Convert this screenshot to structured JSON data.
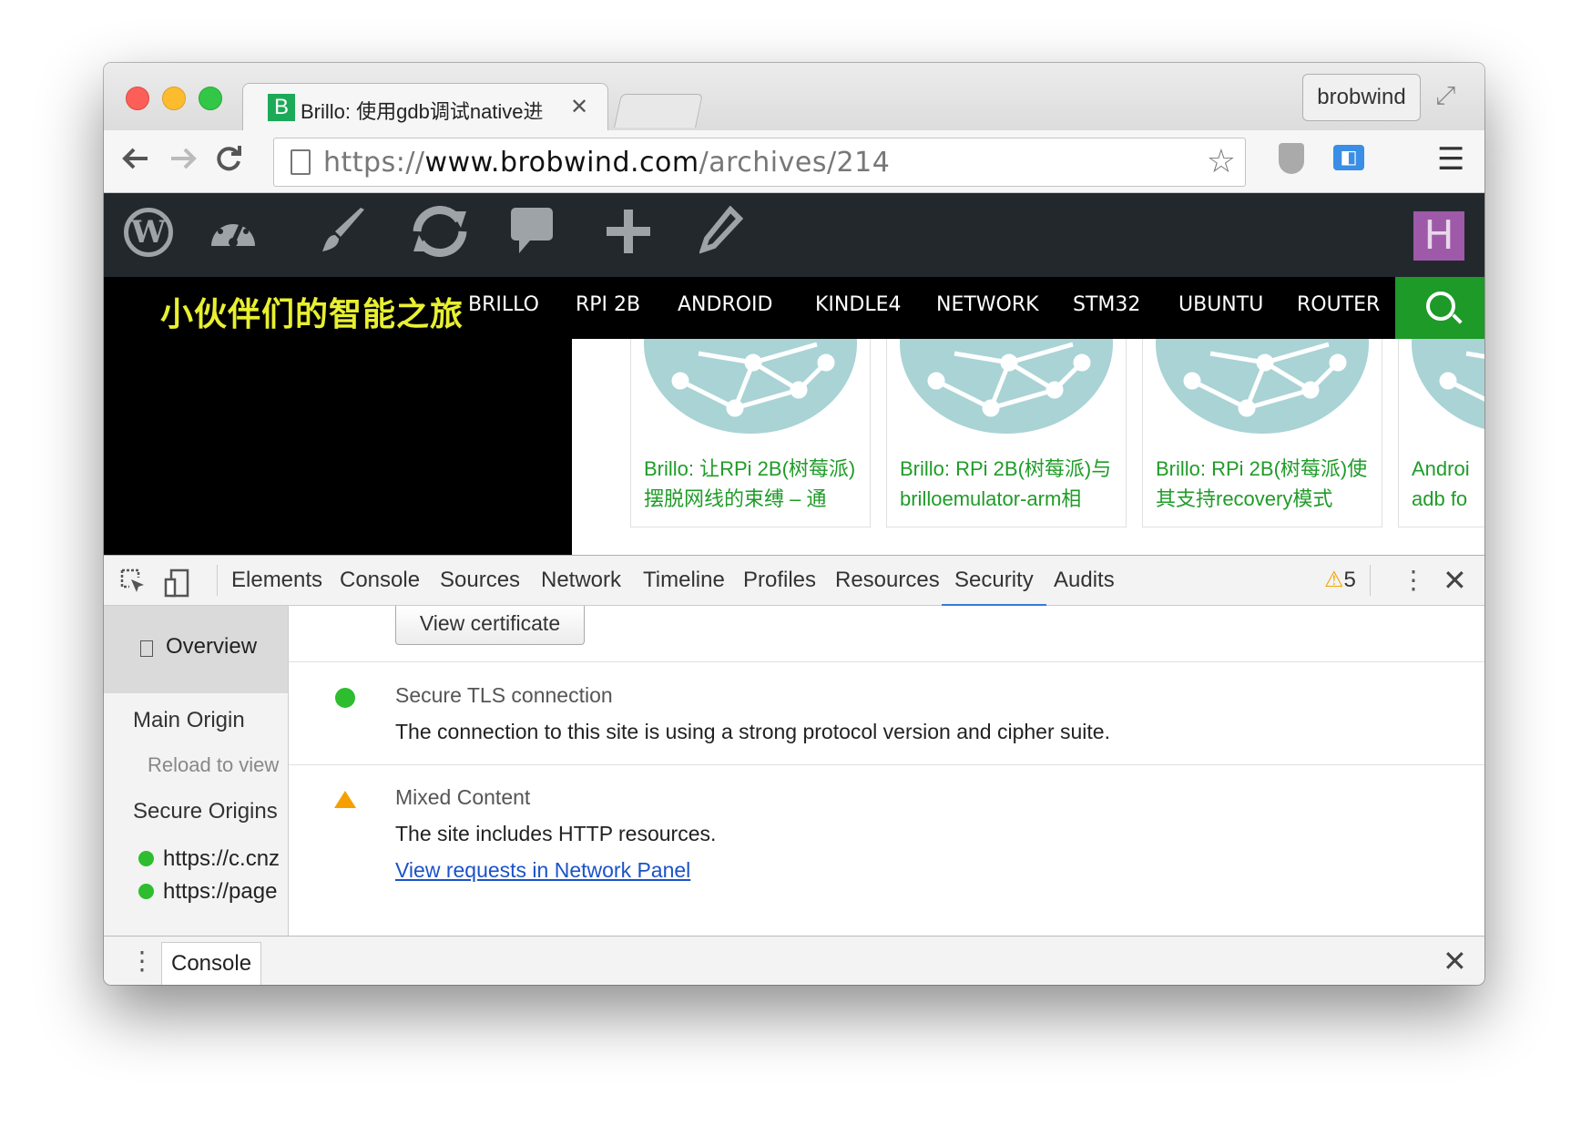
{
  "browser": {
    "tab_title": "Brillo: 使用gdb调试native进",
    "tab_favicon": "B",
    "profile_name": "brobwind",
    "url_scheme": "https://",
    "url_host": "www.brobwind.com",
    "url_path": "/archives/214"
  },
  "wp_admin": {
    "icons": [
      "wordpress-icon",
      "dashboard-icon",
      "brush-icon",
      "update-icon",
      "comment-icon",
      "plus-icon",
      "pencil-icon"
    ],
    "avatar_letter": "H"
  },
  "site": {
    "title": "小伙伴们的智能之旅",
    "nav": [
      "BRILLO",
      "RPI 2B",
      "ANDROID",
      "KINDLE4",
      "NETWORK",
      "STM32",
      "UBUNTU",
      "ROUTER"
    ],
    "cards": [
      {
        "line1": "Brillo: 让RPi 2B(树莓派)",
        "line2": "摆脱网线的束缚 – 通"
      },
      {
        "line1": "Brillo: RPi 2B(树莓派)与",
        "line2": "brilloemulator-arm相"
      },
      {
        "line1": "Brillo: RPi 2B(树莓派)使",
        "line2": "其支持recovery模式"
      },
      {
        "line1": "Androi",
        "line2": "adb fo"
      }
    ]
  },
  "devtools": {
    "tabs": [
      "Elements",
      "Console",
      "Sources",
      "Network",
      "Timeline",
      "Profiles",
      "Resources",
      "Security",
      "Audits"
    ],
    "active_tab": "Security",
    "warning_count": "5",
    "sidebar": {
      "overview": "Overview",
      "main_origin": "Main Origin",
      "reload_hint": "Reload to view",
      "secure_origins": "Secure Origins",
      "origins": [
        "https://c.cnz",
        "https://page"
      ]
    },
    "main": {
      "view_certificate": "View certificate",
      "tls_title": "Secure TLS connection",
      "tls_desc": "The connection to this site is using a strong protocol version and cipher suite.",
      "mixed_title": "Mixed Content",
      "mixed_desc": "The site includes HTTP resources.",
      "mixed_link": "View requests in Network Panel"
    },
    "drawer_tab": "Console"
  },
  "colors": {
    "site_title": "#e8f030",
    "card_text": "#1f9c28",
    "search_bg": "#1d9a28",
    "secure_green": "#2ebd2e",
    "warning_orange": "#f5a000",
    "link_blue": "#1a53c8"
  }
}
